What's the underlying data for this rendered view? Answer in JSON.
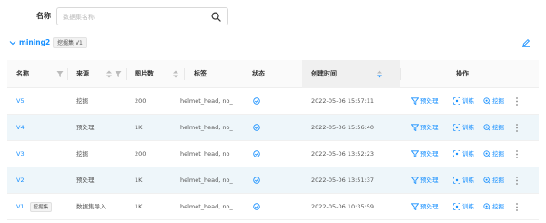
{
  "search": {
    "label": "名称",
    "placeholder": "数据集名称",
    "value": ""
  },
  "group": {
    "name": "mining2",
    "tag": "挖掘集 V1"
  },
  "columns": {
    "name": "名称",
    "source": "来源",
    "image_count": "图片数",
    "tags": "标签",
    "status": "状态",
    "created": "创建时间",
    "actions": "操作"
  },
  "actions": {
    "preprocess": "预处理",
    "train": "训练",
    "mine": "挖掘"
  },
  "rows": [
    {
      "name": "V5",
      "tag": "",
      "source": "挖掘",
      "count": "200",
      "tags": "helmet_head, no_",
      "status": "completed",
      "created": "2022-05-06 15:57:11"
    },
    {
      "name": "V4",
      "tag": "",
      "source": "预处理",
      "count": "1K",
      "tags": "helmet_head, no_",
      "status": "completed",
      "created": "2022-05-06 15:56:40"
    },
    {
      "name": "V3",
      "tag": "",
      "source": "挖掘",
      "count": "200",
      "tags": "helmet_head, no_",
      "status": "completed",
      "created": "2022-05-06 13:52:23"
    },
    {
      "name": "V2",
      "tag": "",
      "source": "预处理",
      "count": "1K",
      "tags": "helmet_head, no_",
      "status": "completed",
      "created": "2022-05-06 13:51:37"
    },
    {
      "name": "V1",
      "tag": "挖掘集",
      "source": "数据集导入",
      "count": "1K",
      "tags": "helmet_head, no_",
      "status": "completed",
      "created": "2022-05-06 10:35:59"
    }
  ],
  "colors": {
    "accent": "#1890ff",
    "status_ok": "#1890ff",
    "row_alt": "#eef6fa"
  },
  "icons": [
    "search-icon",
    "chevron-down-icon",
    "edit-icon",
    "filter-icon",
    "sort-icon",
    "check-circle-icon",
    "funnel-icon",
    "train-icon",
    "mine-icon",
    "more-icon"
  ]
}
